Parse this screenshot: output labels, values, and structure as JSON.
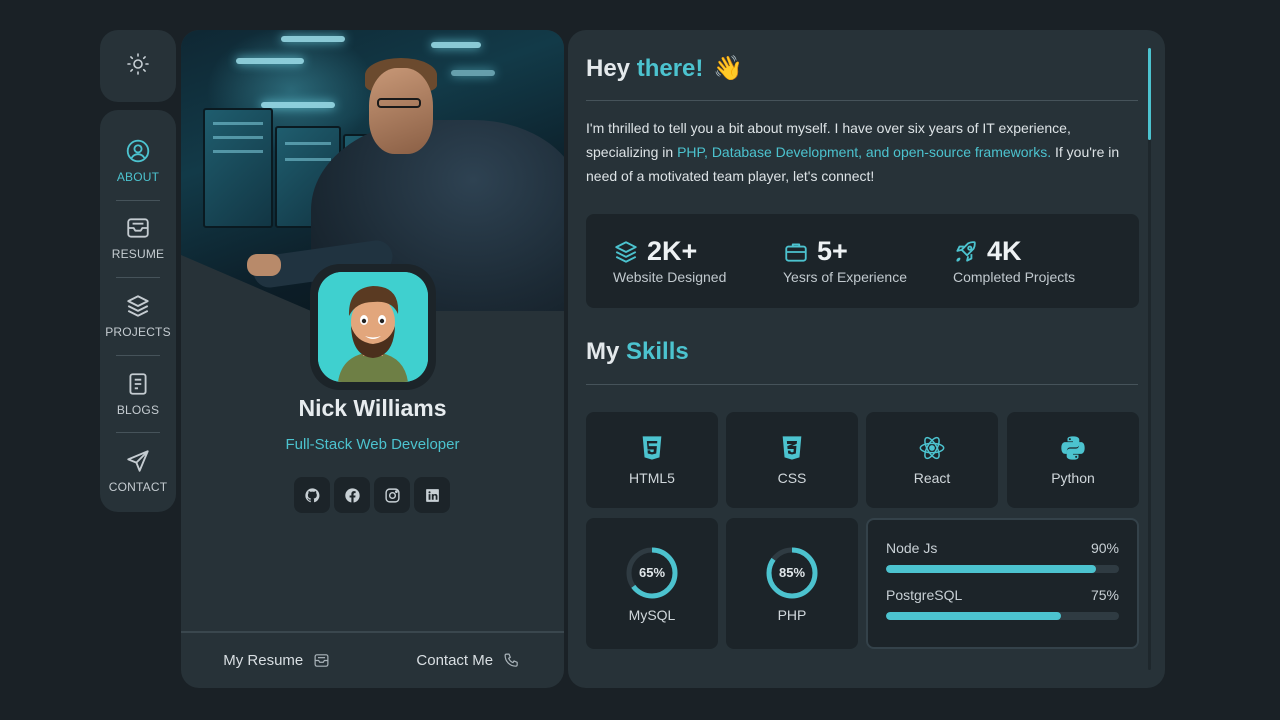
{
  "nav": {
    "items": [
      {
        "label": "ABOUT",
        "icon": "user-circle-icon",
        "active": true
      },
      {
        "label": "RESUME",
        "icon": "inbox-icon",
        "active": false
      },
      {
        "label": "PROJECTS",
        "icon": "layers-icon",
        "active": false
      },
      {
        "label": "BLOGS",
        "icon": "document-icon",
        "active": false
      },
      {
        "label": "CONTACT",
        "icon": "send-icon",
        "active": false
      }
    ],
    "theme_icon": "sun-icon"
  },
  "profile": {
    "name": "Nick Williams",
    "role": "Full-Stack Web Developer",
    "socials": [
      "github-icon",
      "facebook-icon",
      "instagram-icon",
      "linkedin-icon"
    ],
    "footer": {
      "resume_label": "My Resume",
      "contact_label": "Contact Me"
    }
  },
  "about": {
    "greeting_1": "Hey",
    "greeting_2": "there!",
    "greeting_emoji": "👋",
    "intro_1": "I'm thrilled to tell you a bit about myself. I have over six years of IT experience, specializing in ",
    "intro_highlight": "PHP, Database Development, and open-source frameworks.",
    "intro_2": " If you're in need of a motivated team player, let's connect!"
  },
  "stats": [
    {
      "value": "2K+",
      "label": "Website Designed",
      "icon": "layers-icon"
    },
    {
      "value": "5+",
      "label": "Yesrs of Experience",
      "icon": "briefcase-icon"
    },
    {
      "value": "4K",
      "label": "Completed Projects",
      "icon": "rocket-icon"
    }
  ],
  "skills": {
    "title_1": "My",
    "title_2": "Skills",
    "tiles": [
      {
        "label": "HTML5",
        "icon": "html5-icon"
      },
      {
        "label": "CSS",
        "icon": "css3-icon"
      },
      {
        "label": "React",
        "icon": "react-icon"
      },
      {
        "label": "Python",
        "icon": "python-icon"
      }
    ],
    "rings": [
      {
        "label": "MySQL",
        "percent": 65,
        "text": "65%"
      },
      {
        "label": "PHP",
        "percent": 85,
        "text": "85%"
      }
    ],
    "bars": [
      {
        "label": "Node Js",
        "percent": 90,
        "text": "90%"
      },
      {
        "label": "PostgreSQL",
        "percent": 75,
        "text": "75%"
      }
    ]
  },
  "colors": {
    "accent": "#4cc3cf",
    "background": "#1a2126",
    "panel": "#273238",
    "card": "#1c2429"
  }
}
